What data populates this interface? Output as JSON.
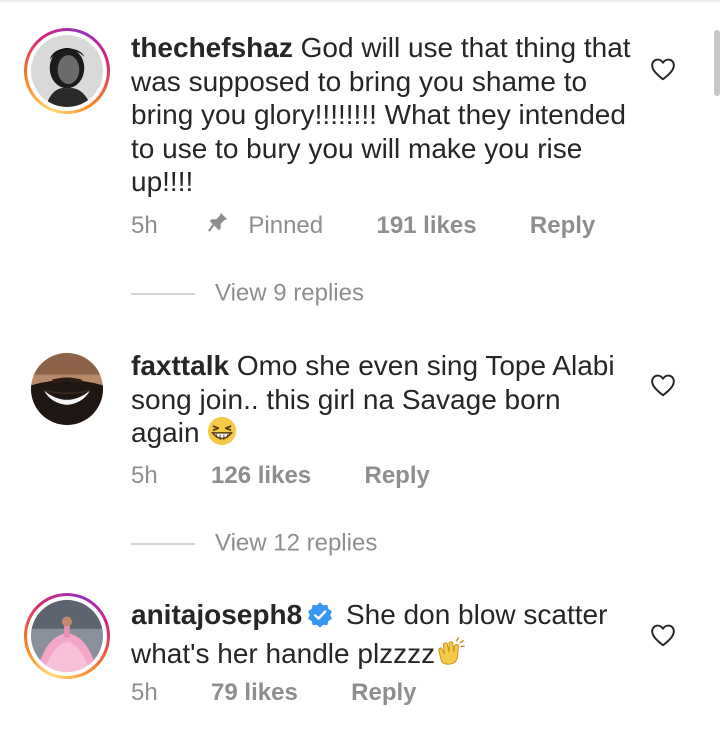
{
  "comments": [
    {
      "username": "thechefshaz",
      "text": "God will use that thing that was supposed to bring you shame to bring you glory!!!!!!!! What they intended to use to bury you will make you rise up!!!!",
      "time": "5h",
      "pinned_label": "Pinned",
      "likes": "191 likes",
      "reply_label": "Reply",
      "view_replies": "View 9 replies",
      "avatar_icon": "profile-photo",
      "has_story_ring": true
    },
    {
      "username": "faxttalk",
      "text": "Omo she even sing Tope Alabi song join.. this girl na Savage born again",
      "emoji": "grinning-squinting-face",
      "time": "5h",
      "likes": "126 likes",
      "reply_label": "Reply",
      "view_replies": "View 12 replies",
      "avatar_icon": "profile-photo",
      "has_story_ring": false
    },
    {
      "username": "anitajoseph8",
      "verified": true,
      "text": "She don blow scatter what's her handle plzzzz",
      "emoji": "clapping-hands",
      "time": "5h",
      "likes": "79 likes",
      "reply_label": "Reply",
      "avatar_icon": "profile-photo",
      "has_story_ring": true
    }
  ],
  "colors": {
    "text": "#262626",
    "secondary": "#8e8e8e",
    "verified_blue": "#3897f0",
    "divider": "#d4d4d4"
  },
  "icons": {
    "like": "heart-outline-icon",
    "pin": "pin-icon",
    "verified": "verified-badge-icon"
  }
}
